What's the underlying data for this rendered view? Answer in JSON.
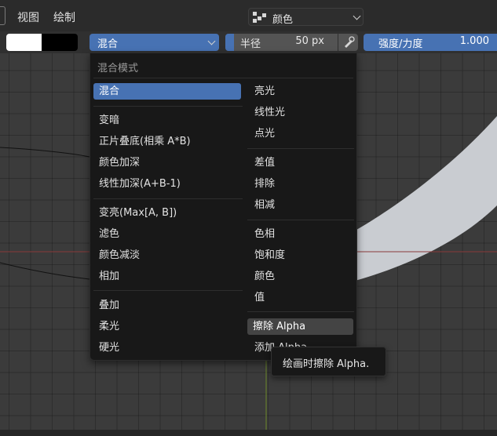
{
  "header": {
    "menu": [
      "视图",
      "绘制"
    ],
    "mode": {
      "label": "颜色",
      "icon": "vertex-paint-icon"
    }
  },
  "toolbar": {
    "primary_color": "#ffffff",
    "secondary_color": "#000000",
    "blend": {
      "label": "混合"
    },
    "radius": {
      "label": "半径",
      "value": "50 px"
    },
    "pressure_icon": "pen-pressure-icon",
    "strength": {
      "label": "强度/力度",
      "value": "1.000"
    }
  },
  "blend_menu": {
    "title": "混合模式",
    "left": {
      "g1": [
        "混合"
      ],
      "g2": [
        "变暗",
        "正片叠底(相乘 A*B)",
        "颜色加深",
        "线性加深(A+B-1)"
      ],
      "g3": [
        "变亮(Max[A, B])",
        "滤色",
        "颜色减淡",
        "相加"
      ],
      "g4": [
        "叠加",
        "柔光",
        "硬光"
      ]
    },
    "right": {
      "g1": [
        "亮光",
        "线性光",
        "点光"
      ],
      "g2": [
        "差值",
        "排除",
        "相减"
      ],
      "g3": [
        "色相",
        "饱和度",
        "颜色",
        "值"
      ],
      "g4": [
        "擦除 Alpha",
        "添加 Alpha"
      ]
    },
    "selected": "混合",
    "hovered": "擦除 Alpha"
  },
  "tooltip": "绘画时擦除 Alpha.",
  "colors": {
    "accent": "#4772b3",
    "menu_bg": "#181818",
    "stroke": "#c9ccd1"
  }
}
